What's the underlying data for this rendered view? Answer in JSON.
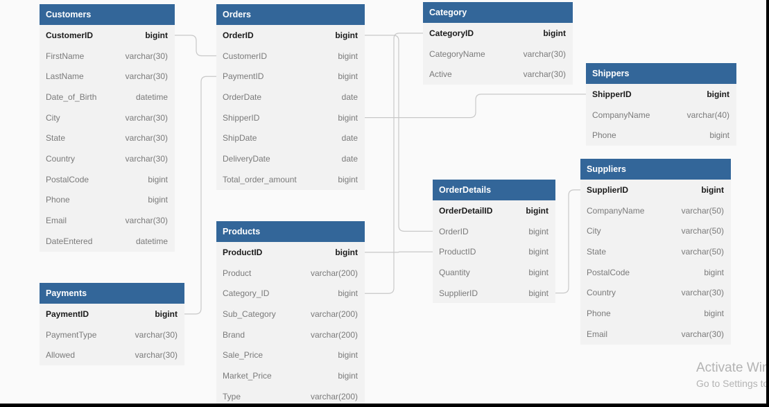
{
  "tables": [
    {
      "id": "customers",
      "title": "Customers",
      "fields": [
        {
          "name": "CustomerID",
          "type": "bigint",
          "pk": true
        },
        {
          "name": "FirstName",
          "type": "varchar(30)"
        },
        {
          "name": "LastName",
          "type": "varchar(30)"
        },
        {
          "name": "Date_of_Birth",
          "type": "datetime"
        },
        {
          "name": "City",
          "type": "varchar(30)"
        },
        {
          "name": "State",
          "type": "varchar(30)"
        },
        {
          "name": "Country",
          "type": "varchar(30)"
        },
        {
          "name": "PostalCode",
          "type": "bigint"
        },
        {
          "name": "Phone",
          "type": "bigint"
        },
        {
          "name": "Email",
          "type": "varchar(30)"
        },
        {
          "name": "DateEntered",
          "type": "datetime"
        }
      ]
    },
    {
      "id": "payments",
      "title": "Payments",
      "fields": [
        {
          "name": "PaymentID",
          "type": "bigint",
          "pk": true
        },
        {
          "name": "PaymentType",
          "type": "varchar(30)"
        },
        {
          "name": "Allowed",
          "type": "varchar(30)"
        }
      ]
    },
    {
      "id": "orders",
      "title": "Orders",
      "fields": [
        {
          "name": "OrderID",
          "type": "bigint",
          "pk": true
        },
        {
          "name": "CustomerID",
          "type": "bigint"
        },
        {
          "name": "PaymentID",
          "type": "bigint"
        },
        {
          "name": "OrderDate",
          "type": "date"
        },
        {
          "name": "ShipperID",
          "type": "bigint"
        },
        {
          "name": "ShipDate",
          "type": "date"
        },
        {
          "name": "DeliveryDate",
          "type": "date"
        },
        {
          "name": "Total_order_amount",
          "type": "bigint"
        }
      ]
    },
    {
      "id": "products",
      "title": "Products",
      "fields": [
        {
          "name": "ProductID",
          "type": "bigint",
          "pk": true
        },
        {
          "name": "Product",
          "type": "varchar(200)"
        },
        {
          "name": "Category_ID",
          "type": "bigint"
        },
        {
          "name": "Sub_Category",
          "type": "varchar(200)"
        },
        {
          "name": "Brand",
          "type": "varchar(200)"
        },
        {
          "name": "Sale_Price",
          "type": "bigint"
        },
        {
          "name": "Market_Price",
          "type": "bigint"
        },
        {
          "name": "Type",
          "type": "varchar(200)"
        }
      ]
    },
    {
      "id": "category",
      "title": "Category",
      "fields": [
        {
          "name": "CategoryID",
          "type": "bigint",
          "pk": true
        },
        {
          "name": "CategoryName",
          "type": "varchar(30)"
        },
        {
          "name": "Active",
          "type": "varchar(30)"
        }
      ]
    },
    {
      "id": "orderdetails",
      "title": "OrderDetails",
      "fields": [
        {
          "name": "OrderDetailID",
          "type": "bigint",
          "pk": true
        },
        {
          "name": "OrderID",
          "type": "bigint"
        },
        {
          "name": "ProductID",
          "type": "bigint"
        },
        {
          "name": "Quantity",
          "type": "bigint"
        },
        {
          "name": "SupplierID",
          "type": "bigint"
        }
      ]
    },
    {
      "id": "shippers",
      "title": "Shippers",
      "fields": [
        {
          "name": "ShipperID",
          "type": "bigint",
          "pk": true
        },
        {
          "name": "CompanyName",
          "type": "varchar(40)"
        },
        {
          "name": "Phone",
          "type": "bigint"
        }
      ]
    },
    {
      "id": "suppliers",
      "title": "Suppliers",
      "fields": [
        {
          "name": "SupplierID",
          "type": "bigint",
          "pk": true
        },
        {
          "name": "CompanyName",
          "type": "varchar(50)"
        },
        {
          "name": "City",
          "type": "varchar(50)"
        },
        {
          "name": "State",
          "type": "varchar(50)"
        },
        {
          "name": "PostalCode",
          "type": "bigint"
        },
        {
          "name": "Country",
          "type": "varchar(30)"
        },
        {
          "name": "Phone",
          "type": "bigint"
        },
        {
          "name": "Email",
          "type": "varchar(30)"
        }
      ]
    }
  ],
  "relationships": [
    {
      "from": "customers.CustomerID",
      "to": "orders.CustomerID"
    },
    {
      "from": "payments.PaymentID",
      "to": "orders.PaymentID"
    },
    {
      "from": "orders.OrderID",
      "to": "orderdetails.OrderID"
    },
    {
      "from": "orders.ShipperID",
      "to": "shippers.ShipperID"
    },
    {
      "from": "products.ProductID",
      "to": "orderdetails.ProductID"
    },
    {
      "from": "products.Category_ID",
      "to": "category.CategoryID"
    },
    {
      "from": "orderdetails.SupplierID",
      "to": "suppliers.SupplierID"
    }
  ],
  "colors": {
    "header": "#336699",
    "body": "#f2f2f2",
    "canvas": "#fafafa",
    "edge": "#c8c8c8"
  },
  "watermark": {
    "title": "Activate Windows",
    "subtitle": "Go to Settings to activate Windows."
  }
}
